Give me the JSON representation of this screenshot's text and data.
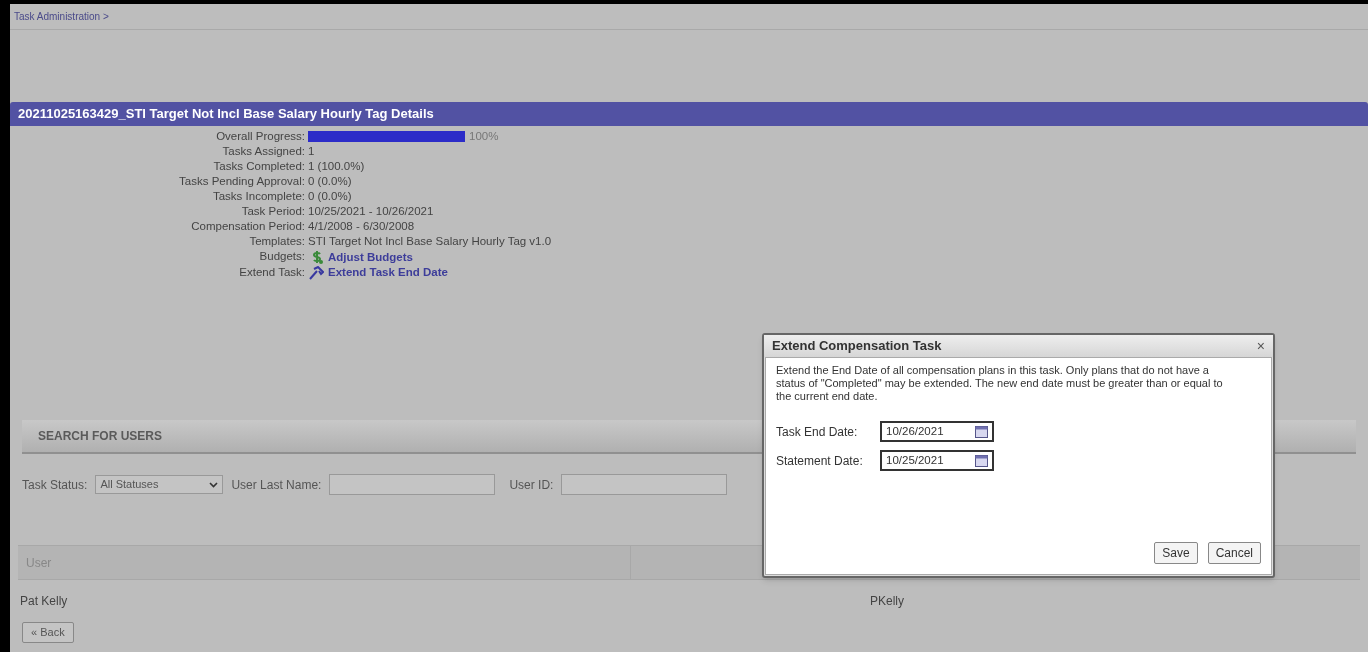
{
  "breadcrumb": {
    "text": "Task Administration >"
  },
  "details": {
    "title": "20211025163429_STI Target Not Incl Base Salary Hourly Tag Details",
    "progress": {
      "label": "Overall Progress:",
      "level": 1.0,
      "reading": "100%"
    },
    "fields": [
      {
        "kind": "text",
        "label": "Tasks Assigned:",
        "value": "1"
      },
      {
        "kind": "text",
        "label": "Tasks Completed:",
        "value": "1 (100.0%)"
      },
      {
        "kind": "text",
        "label": "Tasks Pending Approval:",
        "value": "0 (0.0%)"
      },
      {
        "kind": "text",
        "label": "Tasks Incomplete:",
        "value": "0 (0.0%)"
      },
      {
        "kind": "text",
        "label": "Task Period:",
        "value": "10/25/2021 - 10/26/2021"
      },
      {
        "kind": "text",
        "label": "Compensation Period:",
        "value": "4/1/2008 - 6/30/2008"
      },
      {
        "kind": "text",
        "label": "Templates:",
        "value": "STI Target Not Incl Base Salary Hourly Tag v1.0"
      },
      {
        "kind": "budget_link",
        "label": "Budgets:",
        "value": "Adjust Budgets"
      },
      {
        "kind": "extend_link",
        "label": "Extend Task:",
        "value": "Extend Task End Date"
      }
    ]
  },
  "search": {
    "title": "SEARCH FOR USERS",
    "status_label": "Task Status:",
    "status_value": "All Statuses",
    "last_name_label": "User Last Name:",
    "user_id_label": "User ID:"
  },
  "table": {
    "columns": [
      "User"
    ],
    "rows": [
      {
        "user": "Pat Kelly",
        "column_2": "PKelly"
      }
    ]
  },
  "back_button": "« Back",
  "dialog": {
    "title": "Extend Compensation Task",
    "close": "×",
    "message": "Extend the End Date of all compensation plans in this task. Only plans that do not have a status of \"Completed\" may be extended. The new end date must be greater than or equal to the current end date.",
    "fields": [
      {
        "label": "Task End Date:",
        "value": "10/26/2021"
      },
      {
        "label": "Statement Date:",
        "value": "10/25/2021"
      }
    ],
    "buttons": [
      "Save",
      "Cancel"
    ]
  }
}
